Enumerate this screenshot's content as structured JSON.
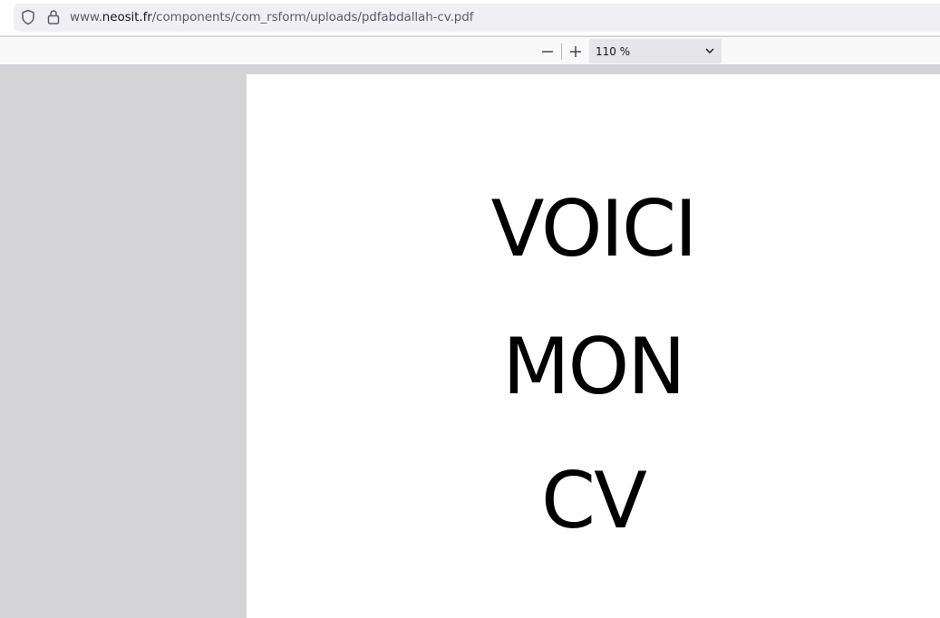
{
  "browser": {
    "url_prefix": "www.",
    "url_host": "neosit.fr",
    "url_path": "/components/com_rsform/uploads/pdfabdallah-cv.pdf"
  },
  "toolbar": {
    "zoom_out_symbol": "—",
    "zoom_in_symbol": "+",
    "zoom_value": "110 %"
  },
  "document": {
    "lines": [
      "VOICI",
      "MON",
      "CV"
    ]
  },
  "colors": {
    "sidebar_bg": "#d4d4d7",
    "page_bg": "#ffffff",
    "urlbar_bg": "#f0f0f4"
  }
}
